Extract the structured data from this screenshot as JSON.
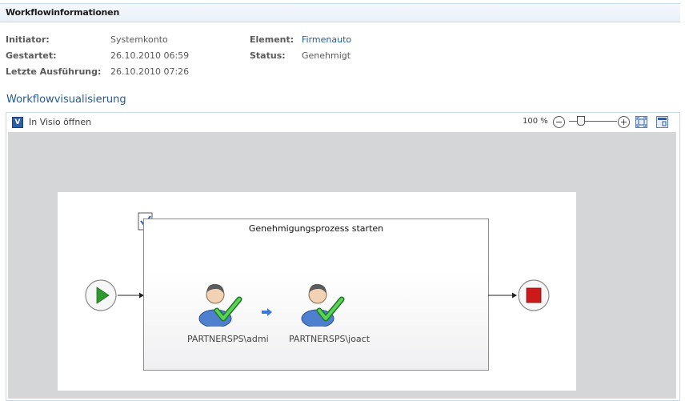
{
  "header": {
    "title": "Workflowinformationen"
  },
  "info": {
    "initiator_label": "Initiator:",
    "initiator_value": "Systemkonto",
    "started_label": "Gestartet:",
    "started_value": "26.10.2010 06:59",
    "last_run_label": "Letzte Ausführung:",
    "last_run_value": "26.10.2010 07:26",
    "element_label": "Element:",
    "element_value": "Firmenauto",
    "status_label": "Status:",
    "status_value": "Genehmigt"
  },
  "visualization": {
    "title": "Workflowvisualisierung",
    "open_visio_label": "In Visio öffnen",
    "zoom_level": "100 %",
    "stage_title": "Genehmigungsprozess starten",
    "approvers": [
      {
        "label": "PARTNERSPS\\admi"
      },
      {
        "label": "PARTNERSPS\\joact"
      }
    ]
  },
  "colors": {
    "link": "#1f5c99",
    "canvas": "#d4d6d8",
    "start_green": "#2e9a2e",
    "end_red": "#cc1a1a"
  }
}
